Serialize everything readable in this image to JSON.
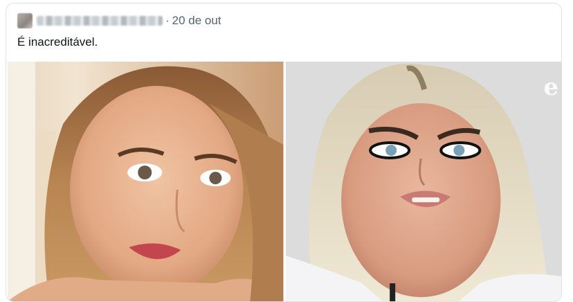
{
  "tweet": {
    "date": "20 de out",
    "separator": "·",
    "text": "É inacreditável."
  },
  "media": {
    "watermark": "e"
  }
}
